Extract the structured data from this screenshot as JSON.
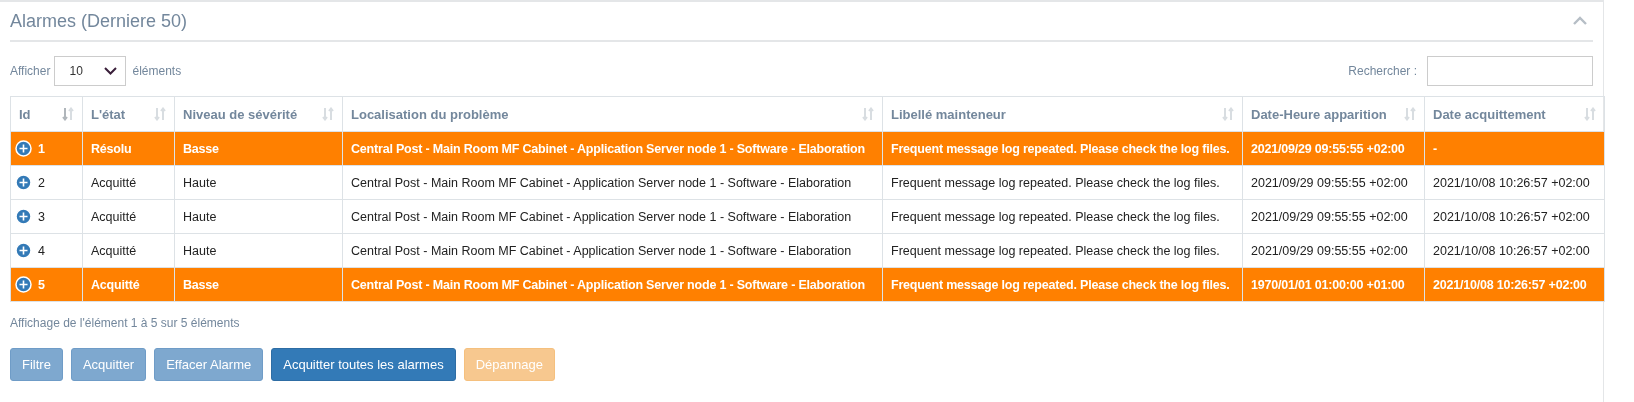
{
  "panel": {
    "title": "Alarmes (Derniere 50)",
    "expanded": true
  },
  "length_control": {
    "label_before": "Afficher",
    "value": "10",
    "label_after": "éléments"
  },
  "search": {
    "label": "Rechercher :"
  },
  "table": {
    "columns": [
      {
        "label": "Id",
        "sorted": true
      },
      {
        "label": "L'état",
        "sorted": false
      },
      {
        "label": "Niveau de sévérité",
        "sorted": false
      },
      {
        "label": "Localisation du problème",
        "sorted": false
      },
      {
        "label": "Libellé mainteneur",
        "sorted": false
      },
      {
        "label": "Date-Heure apparition",
        "sorted": false
      },
      {
        "label": "Date acquittement",
        "sorted": false
      }
    ],
    "rows": [
      {
        "highlighted": true,
        "cells": [
          "1",
          "Résolu",
          "Basse",
          "Central Post - Main Room MF Cabinet - Application Server node 1 - Software - Elaboration",
          "Frequent message log repeated. Please check the log files.",
          "2021/09/29 09:55:55 +02:00",
          "-"
        ]
      },
      {
        "highlighted": false,
        "cells": [
          "2",
          "Acquitté",
          "Haute",
          "Central Post - Main Room MF Cabinet - Application Server node 1 - Software - Elaboration",
          "Frequent message log repeated. Please check the log files.",
          "2021/09/29 09:55:55 +02:00",
          "2021/10/08 10:26:57 +02:00"
        ]
      },
      {
        "highlighted": false,
        "cells": [
          "3",
          "Acquitté",
          "Haute",
          "Central Post - Main Room MF Cabinet - Application Server node 1 - Software - Elaboration",
          "Frequent message log repeated. Please check the log files.",
          "2021/09/29 09:55:55 +02:00",
          "2021/10/08 10:26:57 +02:00"
        ]
      },
      {
        "highlighted": false,
        "cells": [
          "4",
          "Acquitté",
          "Haute",
          "Central Post - Main Room MF Cabinet - Application Server node 1 - Software - Elaboration",
          "Frequent message log repeated. Please check the log files.",
          "2021/09/29 09:55:55 +02:00",
          "2021/10/08 10:26:57 +02:00"
        ]
      },
      {
        "highlighted": true,
        "cells": [
          "5",
          "Acquitté",
          "Basse",
          "Central Post - Main Room MF Cabinet - Application Server node 1 - Software - Elaboration",
          "Frequent message log repeated. Please check the log files.",
          "1970/01/01 01:00:00 +01:00",
          "2021/10/08 10:26:57 +02:00"
        ]
      }
    ]
  },
  "info": "Affichage de l'élément 1 à 5 sur 5 éléments",
  "buttons": [
    {
      "label": "Filtre",
      "kind": "primary",
      "disabled": true
    },
    {
      "label": "Acquitter",
      "kind": "primary",
      "disabled": true
    },
    {
      "label": "Effacer Alarme",
      "kind": "primary",
      "disabled": true
    },
    {
      "label": "Acquitter toutes les alarmes",
      "kind": "primary",
      "disabled": false
    },
    {
      "label": "Dépannage",
      "kind": "warning",
      "disabled": true
    }
  ]
}
